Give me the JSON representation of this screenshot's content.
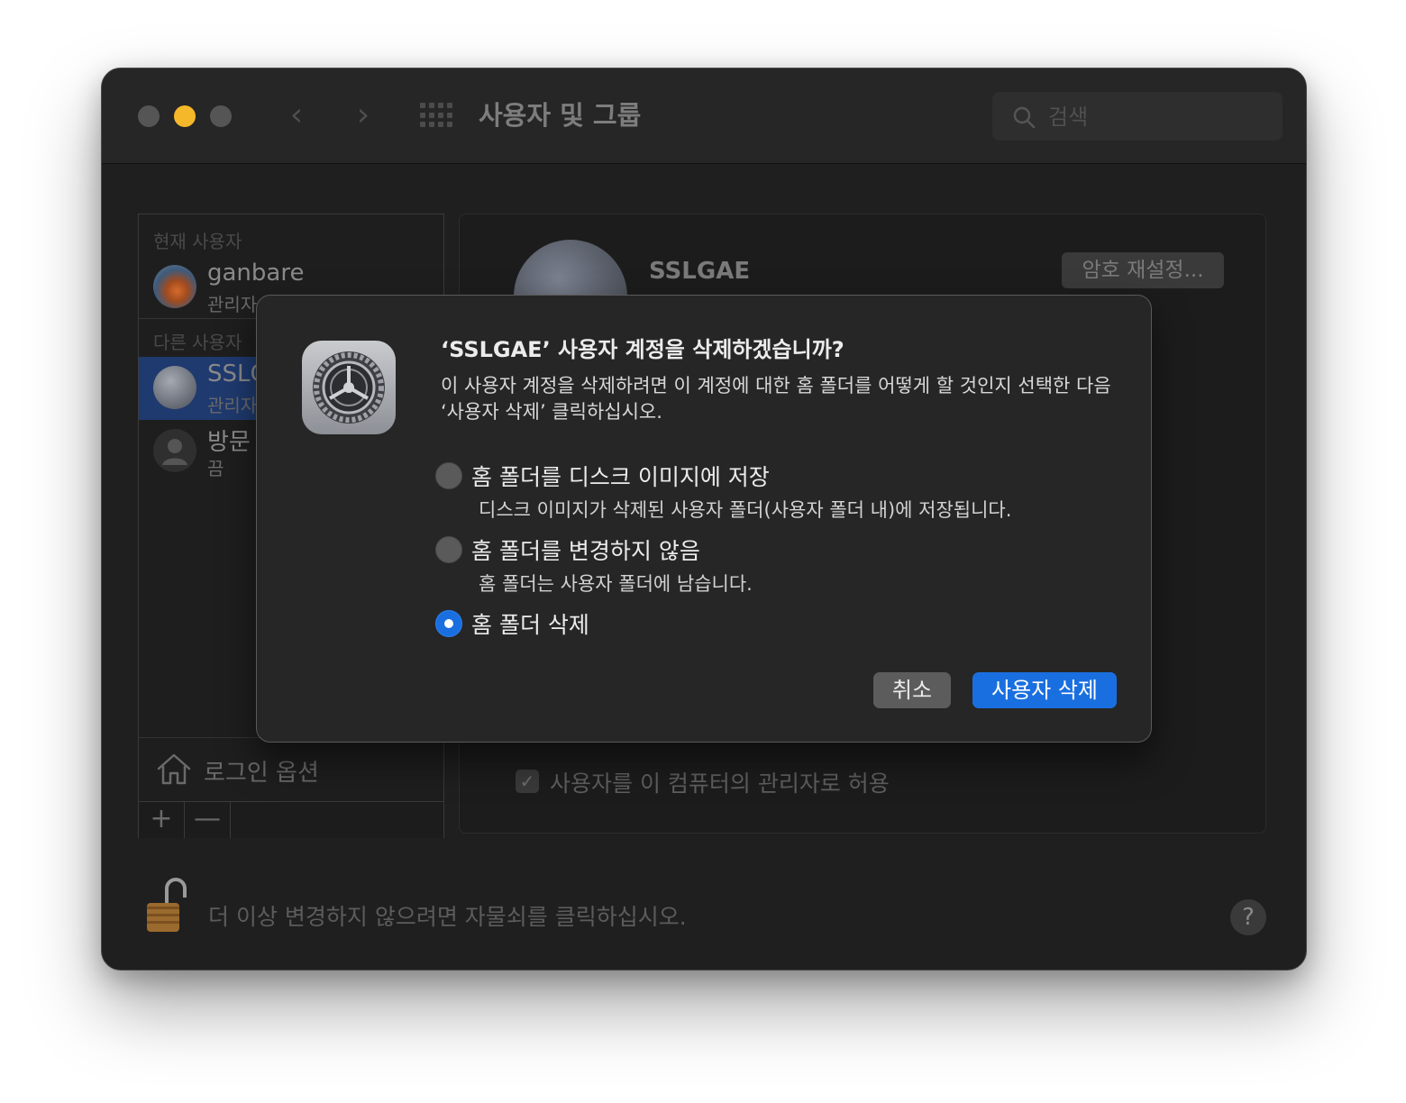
{
  "window": {
    "title": "사용자 및 그룹",
    "search_placeholder": "검색"
  },
  "sidebar": {
    "current_users_label": "현재 사용자",
    "other_users_label": "다른 사용자",
    "users": [
      {
        "name": "ganbare",
        "role": "관리자"
      },
      {
        "name": "SSLGAE",
        "role": "관리자"
      },
      {
        "name": "방문",
        "role": "끔"
      }
    ],
    "login_options": "로그인 옵션",
    "add": "+",
    "remove": "—"
  },
  "content": {
    "user_name": "SSLGAE",
    "reset_password": "암호 재설정...",
    "allow_admin": "사용자를 이 컴퓨터의 관리자로 허용",
    "allow_admin_checked": true
  },
  "footer": {
    "lock_text": "더 이상 변경하지 않으려면 자물쇠를 클릭하십시오.",
    "help": "?"
  },
  "dialog": {
    "title": "‘SSLGAE’ 사용자 계정을 삭제하겠습니까?",
    "message": "이 사용자 계정을 삭제하려면 이 계정에 대한 홈 폴더를 어떻게 할 것인지 선택한 다음 ‘사용자 삭제’ 클릭하십시오.",
    "options": [
      {
        "label": "홈 폴더를 디스크 이미지에 저장",
        "desc": "디스크 이미지가 삭제된 사용자 폴더(사용자 폴더 내)에 저장됩니다.",
        "selected": false
      },
      {
        "label": "홈 폴더를 변경하지 않음",
        "desc": "홈 폴더는 사용자 폴더에 남습니다.",
        "selected": false
      },
      {
        "label": "홈 폴더 삭제",
        "desc": "",
        "selected": true
      }
    ],
    "cancel": "취소",
    "confirm": "사용자 삭제"
  },
  "colors": {
    "accent": "#1a6fe0",
    "minimize_light": "#f5b82a",
    "selection": "#1f3a6f"
  }
}
